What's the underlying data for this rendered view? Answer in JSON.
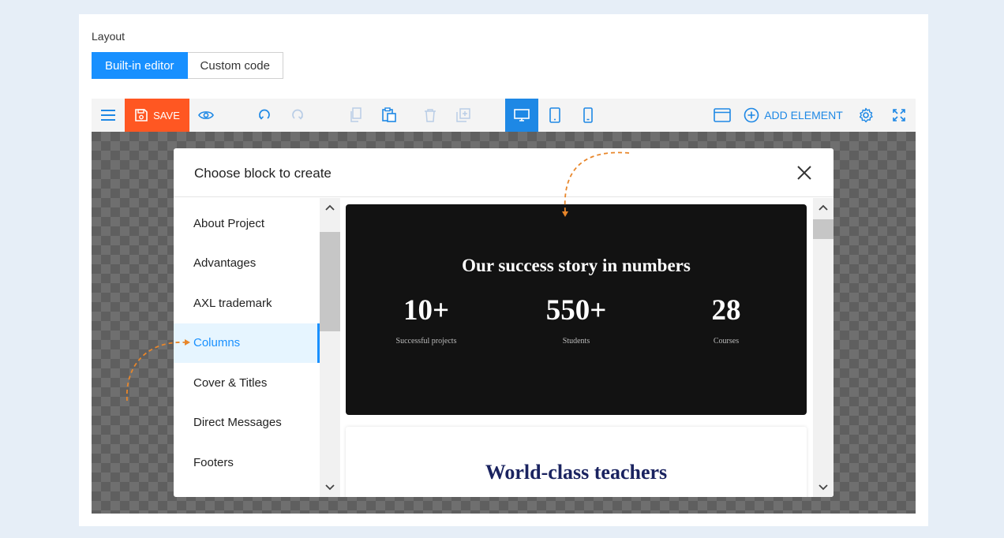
{
  "layout_label": "Layout",
  "mode_tabs": [
    {
      "label": "Built-in editor",
      "active": true
    },
    {
      "label": "Custom code",
      "active": false
    }
  ],
  "toolbar": {
    "save_label": "SAVE",
    "add_element_label": "ADD ELEMENT",
    "active_device": "desktop",
    "accent_color": "#1e88e5",
    "save_color": "#ff5722"
  },
  "modal": {
    "title": "Choose block to create",
    "categories": [
      {
        "label": "About Project",
        "active": false
      },
      {
        "label": "Advantages",
        "active": false
      },
      {
        "label": "AXL trademark",
        "active": false
      },
      {
        "label": "Columns",
        "active": true
      },
      {
        "label": "Cover & Titles",
        "active": false
      },
      {
        "label": "Direct Messages",
        "active": false
      },
      {
        "label": "Footers",
        "active": false
      }
    ]
  },
  "preview": {
    "dark_block": {
      "title": "Our success story in numbers",
      "stats": [
        {
          "value": "10+",
          "label": "Successful projects"
        },
        {
          "value": "550+",
          "label": "Students"
        },
        {
          "value": "28",
          "label": "Courses"
        }
      ]
    },
    "light_block": {
      "title": "World-class teachers"
    }
  }
}
